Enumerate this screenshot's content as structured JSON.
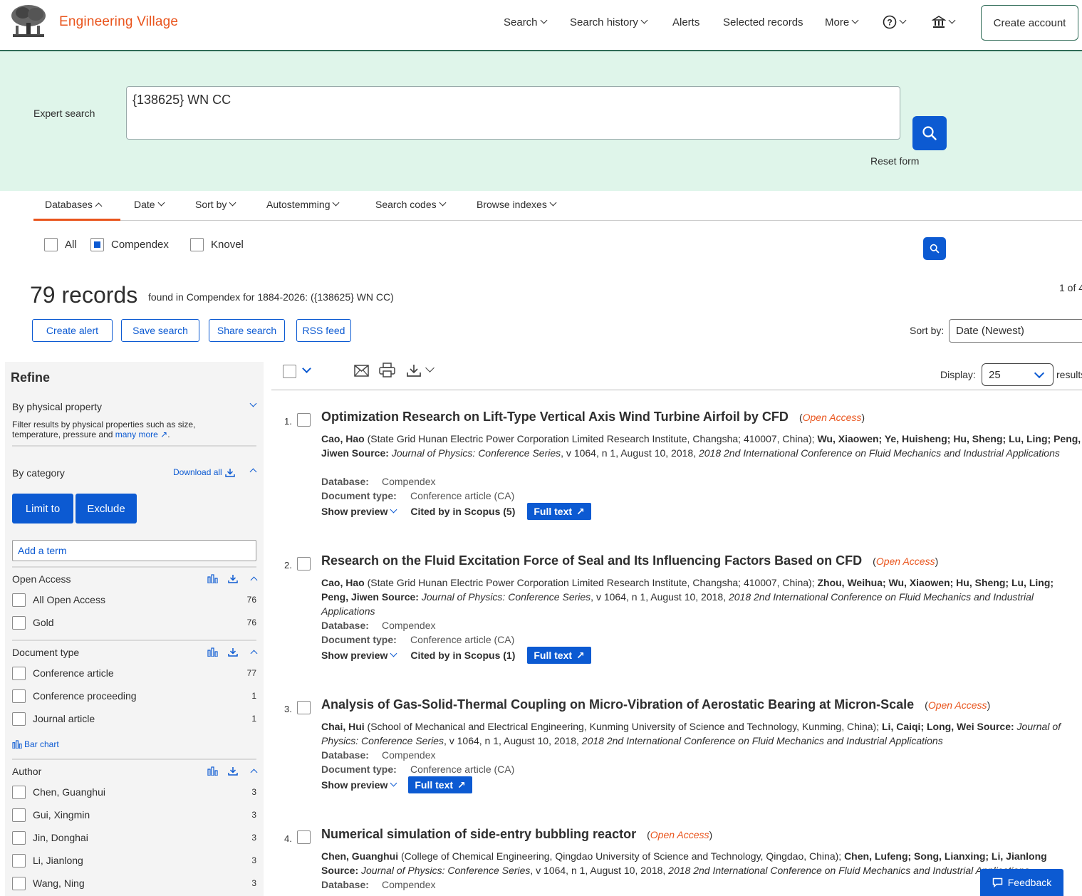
{
  "header": {
    "brand": "Engineering Village",
    "nav": {
      "search": "Search",
      "search_history": "Search history",
      "alerts": "Alerts",
      "selected_records": "Selected records",
      "more": "More"
    },
    "create_account": "Create account"
  },
  "search": {
    "label": "Expert search",
    "query": "{138625} WN CC",
    "reset": "Reset form"
  },
  "tabs": [
    "Databases",
    "Date",
    "Sort by",
    "Autostemming",
    "Search codes",
    "Browse indexes"
  ],
  "databases": [
    {
      "label": "All",
      "checked": false
    },
    {
      "label": "Compendex",
      "checked": true
    },
    {
      "label": "Knovel",
      "checked": false
    }
  ],
  "summary": {
    "count": "79 records",
    "found": "found in Compendex for 1884-2026: ({138625} WN CC)",
    "page": "1 of 4"
  },
  "actions": [
    "Create alert",
    "Save search",
    "Share search",
    "RSS feed"
  ],
  "sort": {
    "label": "Sort by:",
    "value": "Date (Newest)"
  },
  "display": {
    "label": "Display:",
    "value": "25",
    "suffix": "results"
  },
  "refine": {
    "title": "Refine",
    "physical_property": {
      "heading": "By physical property",
      "desc": "Filter results by physical properties such as size, temperature, pressure and",
      "link": "many more",
      "end": "."
    },
    "category": {
      "heading": "By category",
      "download_all": "Download all",
      "limit_to": "Limit to",
      "exclude": "Exclude",
      "add_term": "Add a term"
    },
    "facets": {
      "open_access": {
        "heading": "Open Access",
        "items": [
          {
            "label": "All Open Access",
            "count": "76"
          },
          {
            "label": "Gold",
            "count": "76"
          }
        ]
      },
      "document_type": {
        "heading": "Document type",
        "items": [
          {
            "label": "Conference article",
            "count": "77"
          },
          {
            "label": "Conference proceeding",
            "count": "1"
          },
          {
            "label": "Journal article",
            "count": "1"
          }
        ],
        "bar_chart": "Bar chart"
      },
      "author": {
        "heading": "Author",
        "items": [
          {
            "label": "Chen, Guanghui",
            "count": "3"
          },
          {
            "label": "Gui, Xingmin",
            "count": "3"
          },
          {
            "label": "Jin, Donghai",
            "count": "3"
          },
          {
            "label": "Li, Jianlong",
            "count": "3"
          },
          {
            "label": "Wang, Ning",
            "count": "3"
          }
        ]
      }
    }
  },
  "labels": {
    "open_access": "Open Access",
    "database": "Database:",
    "doc_type": "Document type:",
    "show_preview": "Show preview",
    "full_text": "Full text",
    "source": "Source:"
  },
  "results": [
    {
      "num": "1.",
      "title": "Optimization Research on Lift-Type Vertical Axis Wind Turbine Airfoil by CFD",
      "first_author": "Cao, Hao",
      "affiliation": " (State Grid Hunan Electric Power Corporation Limited Research Institute, Changsha; 410007, China); ",
      "authors_rest": "Wu, Xiaowen; Ye, Huisheng; Hu, Sheng; Lu, Ling; Peng, Jiwen",
      "source": "Journal of Physics: Conference Series",
      "source_detail": ", v 1064, n 1, August 10, 2018, ",
      "conference": "2018 2nd International Conference on Fluid Mechanics and Industrial Applications",
      "database": "Compendex",
      "doc_type": "Conference article (CA)",
      "cited": "Cited by in Scopus (5)"
    },
    {
      "num": "2.",
      "title": "Research on the Fluid Excitation Force of Seal and Its Influencing Factors Based on CFD",
      "first_author": "Cao, Hao",
      "affiliation": " (State Grid Hunan Electric Power Corporation Limited Research Institute, Changsha; 410007, China); ",
      "authors_rest": "Zhou, Weihua; Wu, Xiaowen; Hu, Sheng; Lu, Ling; Peng, Jiwen",
      "source": "Journal of Physics: Conference Series",
      "source_detail": ", v 1064, n 1, August 10, 2018, ",
      "conference": "2018 2nd International Conference on Fluid Mechanics and Industrial Applications",
      "database": "Compendex",
      "doc_type": "Conference article (CA)",
      "cited": "Cited by in Scopus (1)"
    },
    {
      "num": "3.",
      "title": "Analysis of Gas-Solid-Thermal Coupling on Micro-Vibration of Aerostatic Bearing at Micron-Scale",
      "first_author": "Chai, Hui",
      "affiliation": " (School of Mechanical and Electrical Engineering, Kunming University of Science and Technology, Kunming, China); ",
      "authors_rest": "Li, Caiqi; Long, Wei",
      "source": "Journal of Physics: Conference Series",
      "source_detail": ", v 1064, n 1, August 10, 2018, ",
      "conference": "2018 2nd International Conference on Fluid Mechanics and Industrial Applications",
      "database": "Compendex",
      "doc_type": "Conference article (CA)",
      "cited": ""
    },
    {
      "num": "4.",
      "title": "Numerical simulation of side-entry bubbling reactor",
      "first_author": "Chen, Guanghui",
      "affiliation": " (College of Chemical Engineering, Qingdao University of Science and Technology, Qingdao, China); ",
      "authors_rest": "Chen, Lufeng; Song, Lianxing; Li, Jianlong",
      "source": "Journal of Physics: Conference Series",
      "source_detail": ", v 1064, n 1, August 10, 2018, ",
      "conference": "2018 2nd International Conference on Fluid Mechanics and Industrial Applications",
      "database": "Compendex",
      "doc_type": "",
      "cited": ""
    }
  ],
  "feedback": "Feedback"
}
